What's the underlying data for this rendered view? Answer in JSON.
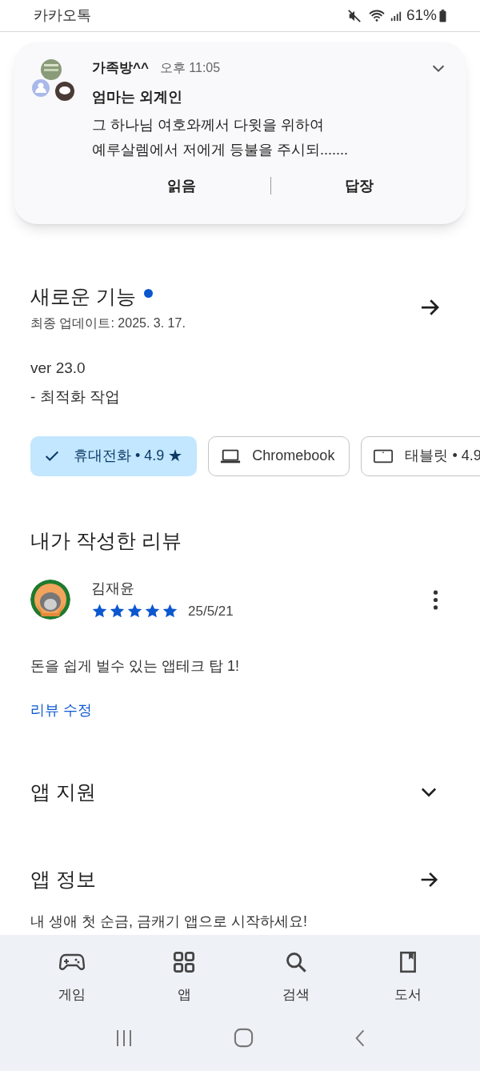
{
  "status_bar": {
    "app": "카카오톡",
    "battery": "61%"
  },
  "notification": {
    "title": "가족방^^",
    "time": "오후 11:05",
    "sender": "엄마는 외계인",
    "lines": [
      "그 하나님 여호와께서 다윗을 위하여",
      "예루살렘에서 저에게 등불을 주시되......."
    ],
    "actions": [
      "읽음",
      "답장"
    ]
  },
  "whats_new": {
    "title": "새로운 기능",
    "updated": "최종 업데이트: 2025. 3. 17.",
    "version": "ver 23.0",
    "notes": "- 최적화 작업"
  },
  "chips": [
    {
      "kind": "phone",
      "label": "휴대전화 • 4.9 ★",
      "selected": true
    },
    {
      "kind": "laptop",
      "label": "Chromebook",
      "selected": false
    },
    {
      "kind": "tablet",
      "label": "태블릿 • 4.9",
      "selected": false
    }
  ],
  "my_review": {
    "title": "내가 작성한 리뷰",
    "author": "김재윤",
    "stars": 5,
    "date": "25/5/21",
    "text": "돈을 쉽게 벌수 있는 앱테크 탑 1!",
    "edit_link": "리뷰 수정"
  },
  "sections": [
    {
      "kind": "expand",
      "title": "앱 지원"
    },
    {
      "kind": "arrow",
      "title": "앱 정보"
    }
  ],
  "app_description": "내 생애 첫 순금, 금캐기 앱으로 시작하세요!",
  "bottom_nav": [
    {
      "kind": "games",
      "label": "게임"
    },
    {
      "kind": "apps",
      "label": "앱"
    },
    {
      "kind": "search",
      "label": "검색"
    },
    {
      "kind": "books",
      "label": "도서"
    }
  ]
}
